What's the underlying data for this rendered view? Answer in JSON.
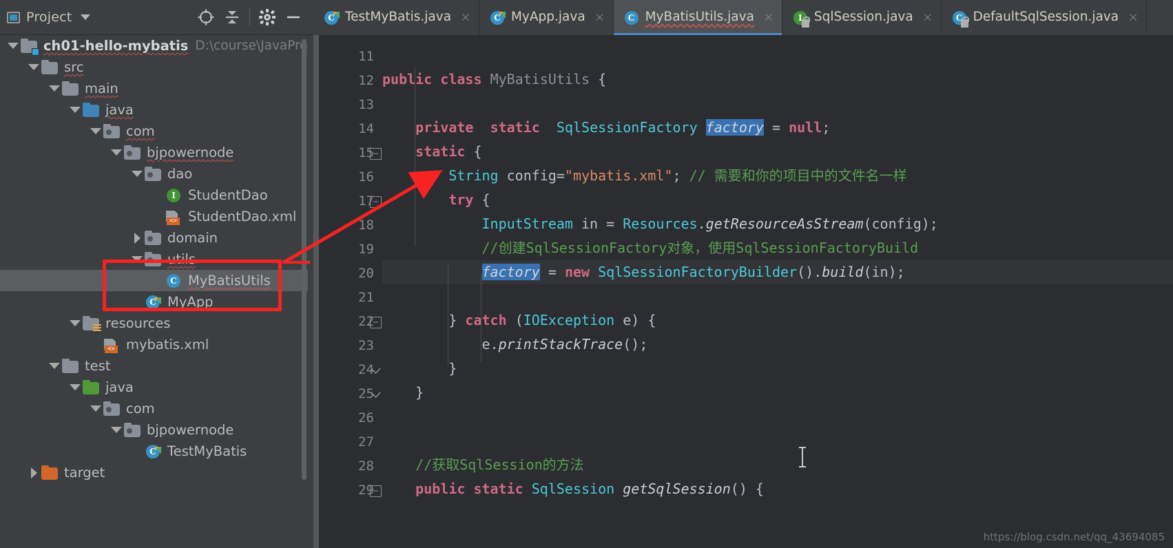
{
  "window": {
    "tool_window_title": "Project",
    "watermark": "https://blog.csdn.net/qq_43694085"
  },
  "toolbar": {
    "locate_icon": "crosshair-locate-icon",
    "collapse_icon": "collapse-all-icon",
    "settings_icon": "gear-icon",
    "hide_icon": "minimize-icon"
  },
  "tabs": [
    {
      "label": "TestMyBatis.java",
      "icon": "java-class-runnable-icon",
      "active": false,
      "close": "×"
    },
    {
      "label": "MyApp.java",
      "icon": "java-class-runnable-icon",
      "active": false,
      "close": "×"
    },
    {
      "label": "MyBatisUtils.java",
      "icon": "java-class-icon",
      "active": true,
      "close": "×"
    },
    {
      "label": "SqlSession.java",
      "icon": "java-interface-locked-icon",
      "active": false,
      "close": "×"
    },
    {
      "label": "DefaultSqlSession.java",
      "icon": "java-class-locked-icon",
      "active": false,
      "close": "×"
    }
  ],
  "tree": [
    {
      "indent": 0,
      "twisty": "down",
      "icon": "module-folder",
      "label": "ch01-hello-mybatis",
      "bold": true,
      "sub": "D:\\course\\JavaProjects\\",
      "selected": false,
      "squiggle": true
    },
    {
      "indent": 1,
      "twisty": "down",
      "icon": "folder",
      "label": "src",
      "bold": false,
      "sub": "",
      "selected": false,
      "squiggle": true
    },
    {
      "indent": 2,
      "twisty": "down",
      "icon": "folder",
      "label": "main",
      "bold": false,
      "sub": "",
      "selected": false,
      "squiggle": true
    },
    {
      "indent": 3,
      "twisty": "down",
      "icon": "folder-blue",
      "label": "java",
      "bold": false,
      "sub": "",
      "selected": false,
      "squiggle": true
    },
    {
      "indent": 4,
      "twisty": "down",
      "icon": "package",
      "label": "com",
      "bold": false,
      "sub": "",
      "selected": false,
      "squiggle": true
    },
    {
      "indent": 5,
      "twisty": "down",
      "icon": "package",
      "label": "bjpowernode",
      "bold": false,
      "sub": "",
      "selected": false,
      "squiggle": true
    },
    {
      "indent": 6,
      "twisty": "down",
      "icon": "package",
      "label": "dao",
      "bold": false,
      "sub": "",
      "selected": false,
      "squiggle": false
    },
    {
      "indent": 7,
      "twisty": "none",
      "icon": "java-interface",
      "label": "StudentDao",
      "bold": false,
      "sub": "",
      "selected": false,
      "squiggle": false
    },
    {
      "indent": 7,
      "twisty": "none",
      "icon": "xml",
      "label": "StudentDao.xml",
      "bold": false,
      "sub": "",
      "selected": false,
      "squiggle": false
    },
    {
      "indent": 6,
      "twisty": "right",
      "icon": "package",
      "label": "domain",
      "bold": false,
      "sub": "",
      "selected": false,
      "squiggle": false
    },
    {
      "indent": 6,
      "twisty": "down",
      "icon": "package",
      "label": "utils",
      "bold": false,
      "sub": "",
      "selected": false,
      "squiggle": true
    },
    {
      "indent": 7,
      "twisty": "none",
      "icon": "java-class",
      "label": "MyBatisUtils",
      "bold": false,
      "sub": "",
      "selected": true,
      "squiggle": true
    },
    {
      "indent": 6,
      "twisty": "none",
      "icon": "java-class-run",
      "label": "MyApp",
      "bold": false,
      "sub": "",
      "selected": false,
      "squiggle": false
    },
    {
      "indent": 3,
      "twisty": "down",
      "icon": "folder-resources",
      "label": "resources",
      "bold": false,
      "sub": "",
      "selected": false,
      "squiggle": false
    },
    {
      "indent": 4,
      "twisty": "none",
      "icon": "xml",
      "label": "mybatis.xml",
      "bold": false,
      "sub": "",
      "selected": false,
      "squiggle": false
    },
    {
      "indent": 2,
      "twisty": "down",
      "icon": "folder",
      "label": "test",
      "bold": false,
      "sub": "",
      "selected": false,
      "squiggle": false
    },
    {
      "indent": 3,
      "twisty": "down",
      "icon": "folder-green",
      "label": "java",
      "bold": false,
      "sub": "",
      "selected": false,
      "squiggle": false
    },
    {
      "indent": 4,
      "twisty": "down",
      "icon": "package",
      "label": "com",
      "bold": false,
      "sub": "",
      "selected": false,
      "squiggle": false
    },
    {
      "indent": 5,
      "twisty": "down",
      "icon": "package",
      "label": "bjpowernode",
      "bold": false,
      "sub": "",
      "selected": false,
      "squiggle": false
    },
    {
      "indent": 6,
      "twisty": "none",
      "icon": "java-class-run",
      "label": "TestMyBatis",
      "bold": false,
      "sub": "",
      "selected": false,
      "squiggle": false
    },
    {
      "indent": 1,
      "twisty": "right",
      "icon": "folder-orange",
      "label": "target",
      "bold": false,
      "sub": "",
      "selected": false,
      "squiggle": false
    }
  ],
  "editor": {
    "file": "MyBatisUtils.java",
    "first_visible_line": 11,
    "caret_line": 20,
    "highlighted_identifier": "factory",
    "lines": [
      {
        "no": 11,
        "fold": "",
        "text": ""
      },
      {
        "no": 12,
        "fold": "",
        "text": "public class MyBatisUtils {"
      },
      {
        "no": 13,
        "fold": "",
        "text": ""
      },
      {
        "no": 14,
        "fold": "",
        "text": "    private  static  SqlSessionFactory factory = null;"
      },
      {
        "no": 15,
        "fold": "open",
        "text": "    static {"
      },
      {
        "no": 16,
        "fold": "",
        "text": "        String config=\"mybatis.xml\"; // 需要和你的项目中的文件名一样"
      },
      {
        "no": 17,
        "fold": "open",
        "text": "        try {"
      },
      {
        "no": 18,
        "fold": "",
        "text": "            InputStream in = Resources.getResourceAsStream(config);"
      },
      {
        "no": 19,
        "fold": "",
        "text": "            //创建SqlSessionFactory对象，使用SqlSessionFactoryBuild"
      },
      {
        "no": 20,
        "fold": "",
        "text": "            factory = new SqlSessionFactoryBuilder().build(in);"
      },
      {
        "no": 21,
        "fold": "",
        "text": ""
      },
      {
        "no": 22,
        "fold": "open",
        "text": "        } catch (IOException e) {"
      },
      {
        "no": 23,
        "fold": "",
        "text": "            e.printStackTrace();"
      },
      {
        "no": 24,
        "fold": "close",
        "text": "        }"
      },
      {
        "no": 25,
        "fold": "close",
        "text": "    }"
      },
      {
        "no": 26,
        "fold": "",
        "text": ""
      },
      {
        "no": 27,
        "fold": "",
        "text": ""
      },
      {
        "no": 28,
        "fold": "",
        "text": "    //获取SqlSession的方法"
      },
      {
        "no": 29,
        "fold": "open",
        "text": "    public static SqlSession getSqlSession() {"
      }
    ]
  },
  "annotation": {
    "box_target": "utils / MyBatisUtils tree rows",
    "arrow_color": "#f72222",
    "arrow_from": "tree-red-box",
    "arrow_to": "line-16-String-config"
  },
  "colors": {
    "accent_blue": "#3592c4",
    "annotation_red": "#f72222",
    "keyword_pink": "#cf6b85",
    "comment_green": "#5a9e53",
    "string_orange": "#d98a6a",
    "type_cyan": "#4ec9d9",
    "editor_bg": "#2b2d30",
    "panel_bg": "#3c3f41",
    "selection_bg": "#5b5e60",
    "occurrence_hl": "#3a72b0"
  }
}
